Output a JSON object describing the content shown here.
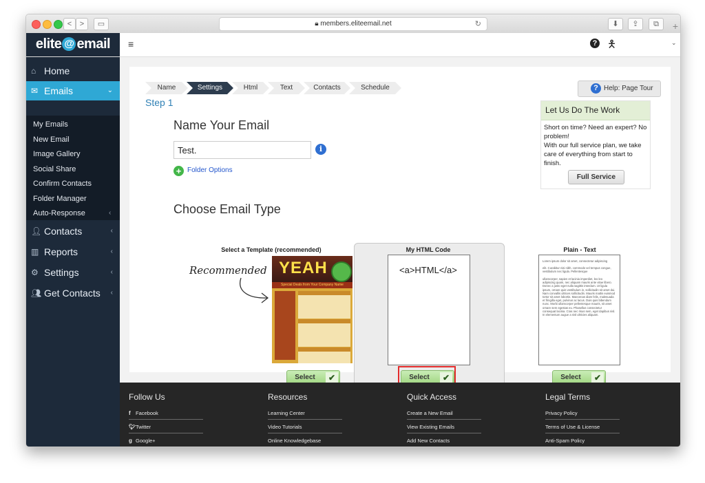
{
  "browser": {
    "url": "members.eliteemail.net",
    "back_glyph": "<",
    "forward_glyph": ">"
  },
  "header": {
    "logo_left": "elite",
    "logo_at": "@",
    "logo_right": "email",
    "menu_glyph": "≡",
    "help_glyph": "?"
  },
  "sidebar": {
    "items": [
      {
        "label": "Home",
        "icon": "home-icon"
      },
      {
        "label": "Emails",
        "icon": "envelope-icon",
        "active": true
      },
      {
        "label": "Contacts",
        "icon": "person-icon"
      },
      {
        "label": "Reports",
        "icon": "bar-chart-icon"
      },
      {
        "label": "Settings",
        "icon": "gear-icon"
      },
      {
        "label": "Get Contacts",
        "icon": "users-icon"
      }
    ],
    "subitems": [
      "My Emails",
      "New Email",
      "Image Gallery",
      "Social Share",
      "Confirm Contacts",
      "Folder Manager",
      "Auto-Response"
    ]
  },
  "wizard": {
    "steps": [
      "Name",
      "Settings",
      "Html",
      "Text",
      "Contacts",
      "Schedule"
    ],
    "active_step": "Settings",
    "step_label": "Step 1",
    "help_tour": "Help: Page Tour"
  },
  "form": {
    "name_heading": "Name Your Email",
    "name_value": "Test.",
    "folder_options": "Folder Options",
    "type_heading": "Choose Email Type"
  },
  "promo": {
    "title": "Let Us Do The Work",
    "body_line1": "Short on time? Need an expert? No problem!",
    "body_line2": "With our full service plan, we take care of everything from start to finish.",
    "button": "Full Service"
  },
  "email_types": [
    {
      "title": "Select a Template (recommended)",
      "button": "Select"
    },
    {
      "title": "My HTML Code",
      "button": "Select",
      "preview": "<a>HTML</a>"
    },
    {
      "title": "Plain - Text",
      "button": "Select"
    }
  ],
  "template_preview": {
    "headline": "YEAH",
    "banner": "Special Deals from Your Company Name"
  },
  "plain_preview": {
    "p1": "Lorem ipsum dolor sit amet, consectetur adipiscing",
    "p2": "elit. Curabitur nisi nibh, commodo vel tempus congue, vestibulum nec ligula. Pellentesque",
    "p3": "ullamcorper, sapien et lacinia imperdiet, leo leo adipiscing quam, nec aliquam mauris ante vitae libero. Donec a justo eget nulla sagittis interdum. Ut ligula ipsum, ornare quis vestibulum in, sollicitudin sit amet dui. Nam convallis ultrices sollicitudin. Mauris mattis euismod tortor sit amet lobortis. Maecenas diam felis, malesuada et fringilla eget, pulvinar ac lacus. Duis quis bibendum nunc. Morbi ullamcorper pellentesque mauris, sit amet ornare sem egestas eu. Phasellus consectetur consequat lacinia. Cras nec risus sem, eget dapibus nisl. In elementum augue a nisl ultricies aliquam."
  },
  "recommended_label": "Recommended",
  "checkmark_glyph": "✔",
  "footer": {
    "columns": [
      {
        "heading": "Follow Us",
        "links": [
          "Facebook",
          "Twitter",
          "Google+"
        ]
      },
      {
        "heading": "Resources",
        "links": [
          "Learning Center",
          "Video Tutorials",
          "Online Knowledgebase"
        ]
      },
      {
        "heading": "Quick Access",
        "links": [
          "Create a New Email",
          "View Existing Emails",
          "Add New Contacts"
        ]
      },
      {
        "heading": "Legal Terms",
        "links": [
          "Privacy Policy",
          "Terms of Use & License",
          "Anti-Spam Policy"
        ]
      }
    ]
  }
}
